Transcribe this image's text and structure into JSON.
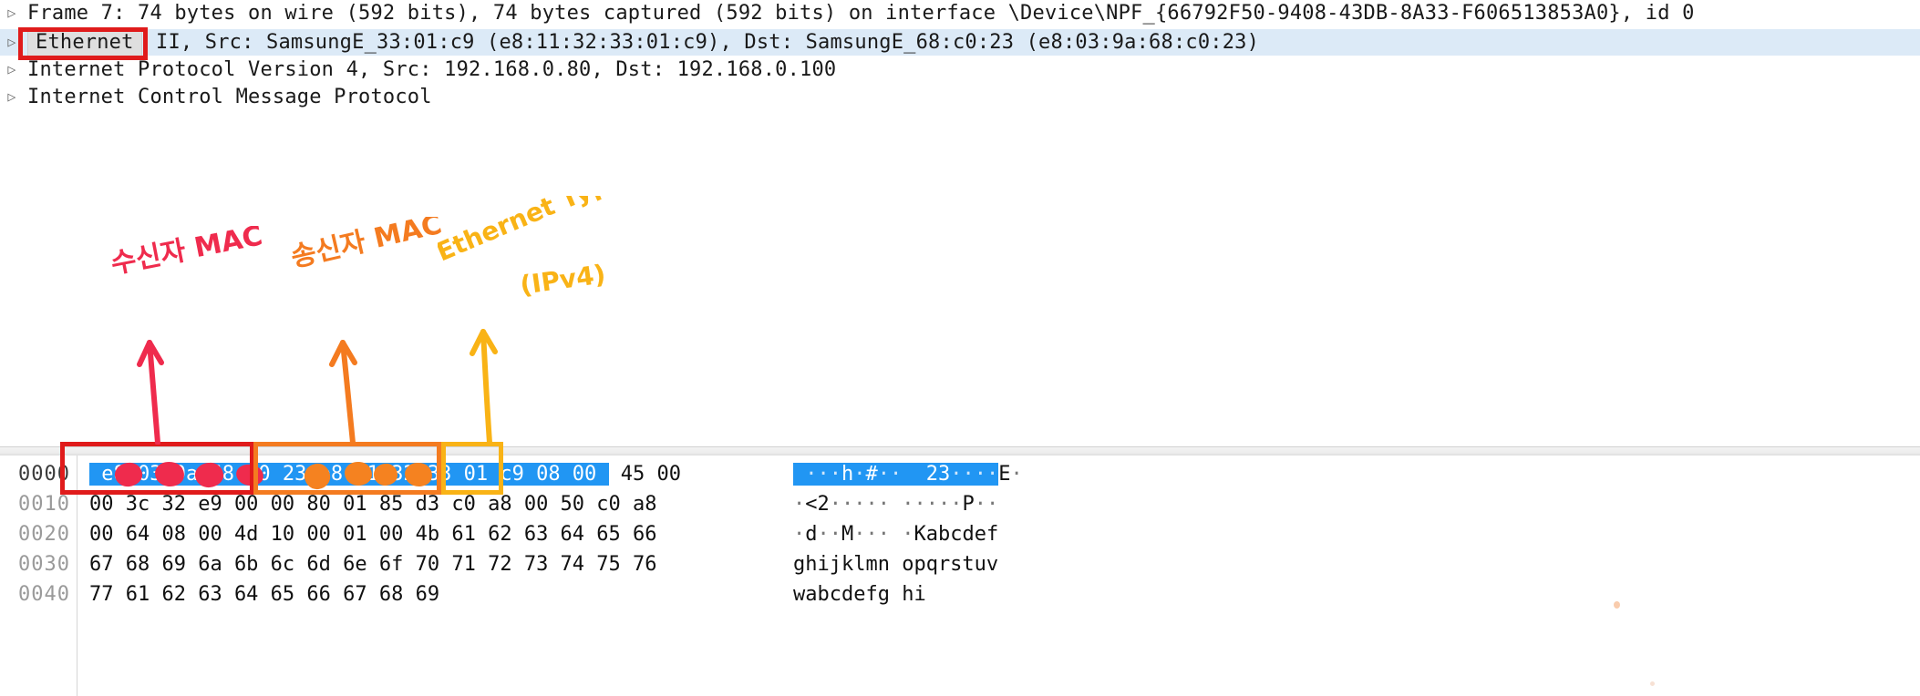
{
  "detail_tree": {
    "rows": [
      {
        "twisty": "▷",
        "text": "Frame 7: 74 bytes on wire (592 bits), 74 bytes captured (592 bits) on interface \\Device\\NPF_{66792F50-9408-43DB-8A33-F606513853A0}, id 0",
        "selected": false
      },
      {
        "twisty": "▷",
        "chip": "Ethernet",
        "text": " II, Src: SamsungE_33:01:c9 (e8:11:32:33:01:c9), Dst: SamsungE_68:c0:23 (e8:03:9a:68:c0:23)",
        "selected": true
      },
      {
        "twisty": "▷",
        "text": "Internet Protocol Version 4, Src: 192.168.0.80, Dst: 192.168.0.100",
        "selected": false
      },
      {
        "twisty": "▷",
        "text": "Internet Control Message Protocol",
        "selected": false
      }
    ]
  },
  "hex_dump": {
    "offsets": [
      "0000",
      "0010",
      "0020",
      "0030",
      "0040"
    ],
    "rows": [
      {
        "offset": "0000",
        "bytes": "e8 ·· ·· ·· ·· 23  e8 ·· ·· ·· ·· c9  08 00  45 00",
        "bytes_raw": "e8 03 9a 68 c0 23 e8 11 32 33 01 c9 08 00 45 00",
        "ascii": "···h·#··  23····E·"
      },
      {
        "offset": "0010",
        "bytes": "00 3c 32 e9 00 00  80 01  85 d3 c0 a8  00 50  c0 a8",
        "bytes_raw": "00 3c 32 e9 00 00 80 01 85 d3 c0 a8 00 50 c0 a8",
        "ascii": "·<2·····  ·····P··"
      },
      {
        "offset": "0020",
        "bytes": "00 64 08 00 4d 10 00 01  00 4b 61 62 63 64 65 66",
        "bytes_raw": "00 64 08 00 4d 10 00 01 00 4b 61 62 63 64 65 66",
        "ascii": "·d··M···  ·Kabcdef"
      },
      {
        "offset": "0030",
        "bytes": "67 68 69 6a 6b 6c 6d 6e  6f 70 71 72 73 74 75 76",
        "bytes_raw": "67 68 69 6a 6b 6c 6d 6e 6f 70 71 72 73 74 75 76",
        "ascii": "ghijklmn opqrstuv"
      },
      {
        "offset": "0040",
        "bytes": "77 61 62 63 64 65 66 67  68 69",
        "bytes_raw": "77 61 62 63 64 65 66 67 68 69",
        "ascii": "wabcdefg hi"
      }
    ],
    "selection_note": "First row bytes 0-13 and ASCII columns highlighted blue"
  },
  "annotations": {
    "destination_mac": {
      "label": "수신자 MAC",
      "color": "#ef2b4d",
      "box_color": "#e01b1b"
    },
    "source_mac": {
      "label": "송신자 MAC",
      "color": "#f47b20",
      "box_color": "#f47b20"
    },
    "ethernet_type": {
      "label": "Ethernet Type",
      "label2": "(IPv4)",
      "color": "#f9b316",
      "box_color": "#f9b316"
    },
    "ethernet_highlight": {
      "label": "Ethernet",
      "box_color": "#e01b1b"
    }
  },
  "colors": {
    "selection_blue": "#2196f3",
    "row_highlight": "#dceaf7",
    "red": "#e01b1b",
    "orange": "#f47b20",
    "yellow": "#f9b316",
    "offset_grey": "#9a9a9a"
  }
}
